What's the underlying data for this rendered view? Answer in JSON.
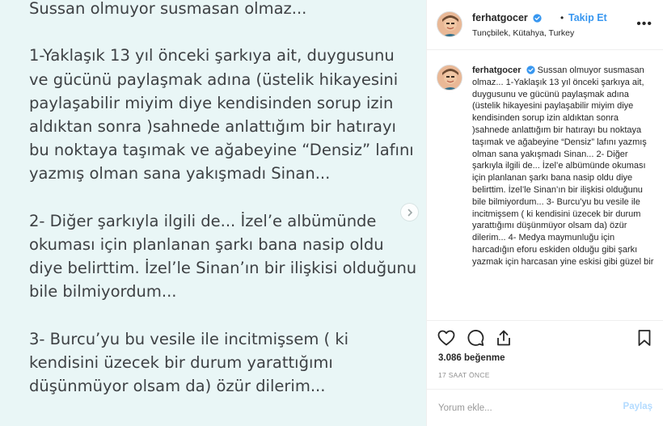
{
  "media": {
    "text": "Sussan olmuyor susmasan olmaz...\n\n1-Yaklaşık 13 yıl önceki şarkıya ait, duygusunu ve gücünü paylaşmak adına (üstelik hikayesini paylaşabilir miyim diye kendisinden sorup izin aldıktan sonra )sahnede anlattığım  bir hatırayı bu noktaya taşımak ve ağabeyine “Densiz” lafını yazmış olman sana yakışmadı Sinan...\n\n2- Diğer şarkıyla ilgili de...   İzel’e albümünde okuması için planlanan şarkı bana nasip oldu diye belirttim.   İzel’le Sinan’ın bir ilişkisi olduğunu bile bilmiyordum...\n\n3- Burcu’yu bu vesile ile incitmişsem ( ki kendisini üzecek bir durum yarattığımı düşünmüyor olsam da) özür dilerim...",
    "next_icon": "chevron-right-icon"
  },
  "header": {
    "username": "ferhatgocer",
    "dot": "•",
    "follow_label": "Takip Et",
    "location": "Tunçbilek, Kütahya, Turkey",
    "more_icon": "more-options-icon",
    "more_label": "•••"
  },
  "caption": {
    "username": "ferhatgocer",
    "text": "Sussan olmuyor susmasan olmaz... 1-Yaklaşık 13 yıl önceki şarkıya ait, duygusunu ve gücünü paylaşmak adına (üstelik hikayesini paylaşabilir miyim diye kendisinden sorup izin aldıktan sonra )sahnede anlattığım bir hatırayı bu noktaya taşımak ve ağabeyine “Densiz” lafını yazmış olman sana yakışmadı Sinan... 2- Diğer şarkıyla ilgili de... İzel’e albümünde okuması için planlanan şarkı bana nasip oldu diye belirttim. İzel’le Sinan’ın bir ilişkisi olduğunu bile bilmiyordum... 3- Burcu’yu bu vesile ile incitmişsem ( ki kendisini üzecek bir durum yarattığımı düşünmüyor olsam da) özür dilerim... 4- Medya maymunluğu için harcadığın eforu eskiden olduğu gibi şarkı yazmak için harcasan yine eskisi gibi güzel bir"
  },
  "actions": {
    "like_icon": "heart-icon",
    "comment_icon": "comment-icon",
    "share_icon": "share-icon",
    "save_icon": "bookmark-icon"
  },
  "stats": {
    "likes": "3.086 beğenme",
    "time": "17 SAAT ÖNCE"
  },
  "comment": {
    "placeholder": "Yorum ekle...",
    "post_label": "Paylaş"
  },
  "colors": {
    "media_bg": "#e9f6f6",
    "link_blue": "#3897f0",
    "post_disabled": "#b3dbff"
  }
}
